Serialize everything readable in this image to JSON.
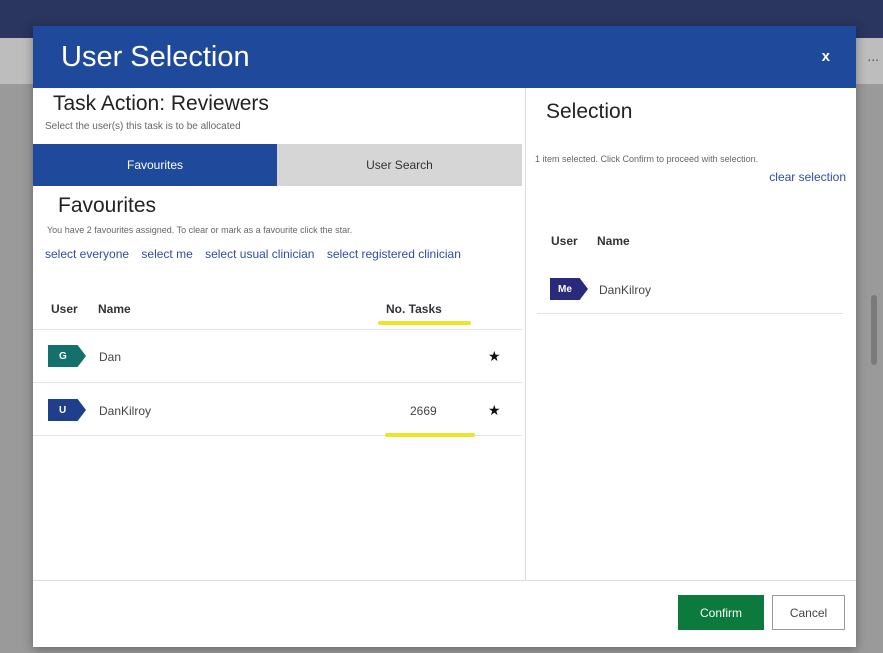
{
  "modal": {
    "title": "User Selection",
    "close_label": "x"
  },
  "left": {
    "heading": "Task Action: Reviewers",
    "subtext": "Select the user(s) this task is to be allocated",
    "tabs": [
      {
        "label": "Favourites",
        "active": true
      },
      {
        "label": "User Search",
        "active": false
      }
    ],
    "favourites": {
      "heading": "Favourites",
      "info": "You have 2 favourites assigned. To clear or mark as a favourite click the star.",
      "links": [
        "select everyone",
        "select me",
        "select usual clinician",
        "select registered clinician"
      ],
      "columns": {
        "user": "User",
        "name": "Name",
        "tasks": "No. Tasks"
      },
      "rows": [
        {
          "badge": "G",
          "badge_color": "#13706c",
          "name": "Dan",
          "tasks": "",
          "star": "★"
        },
        {
          "badge": "U",
          "badge_color": "#1f3f8c",
          "name": "DanKilroy",
          "tasks": "2669",
          "star": "★"
        }
      ]
    }
  },
  "right": {
    "heading": "Selection",
    "info": "1 item selected. Click Confirm to proceed with selection.",
    "clear_label": "clear selection",
    "columns": {
      "user": "User",
      "name": "Name"
    },
    "rows": [
      {
        "badge": "Me",
        "badge_color": "#2a2a7a",
        "name": "DanKilroy"
      }
    ]
  },
  "footer": {
    "confirm_label": "Confirm",
    "cancel_label": "Cancel"
  },
  "background": {
    "more_label": "..."
  },
  "colors": {
    "header": "#1f4a9c",
    "confirm": "#0c7a3c",
    "link": "#2c4ea3",
    "highlight": "#f2e22a"
  }
}
